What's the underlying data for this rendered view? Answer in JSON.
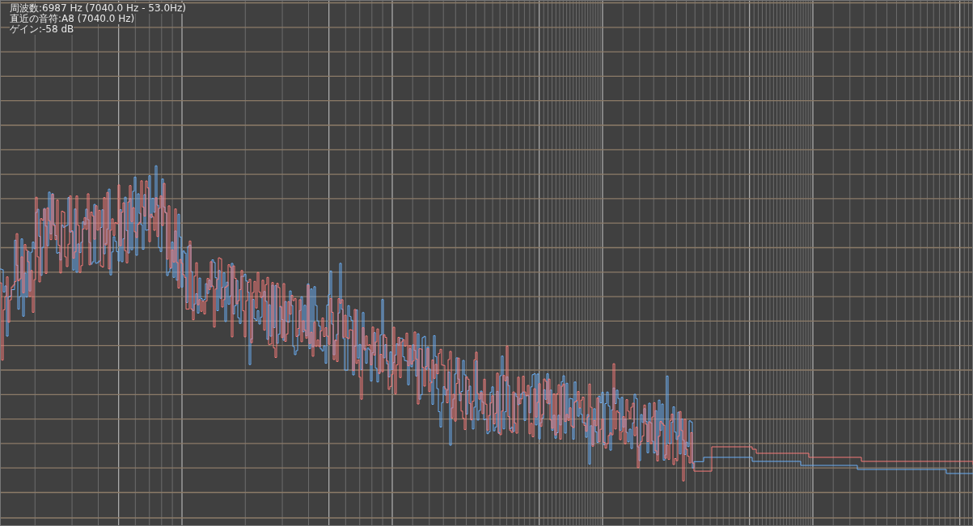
{
  "readout": {
    "lines": [
      "周波数:6987 Hz (7040.0 Hz - 53.0Hz)",
      "直近の音符:A8 (7040.0 Hz)",
      "ゲイン:-58 dB"
    ]
  }
}
